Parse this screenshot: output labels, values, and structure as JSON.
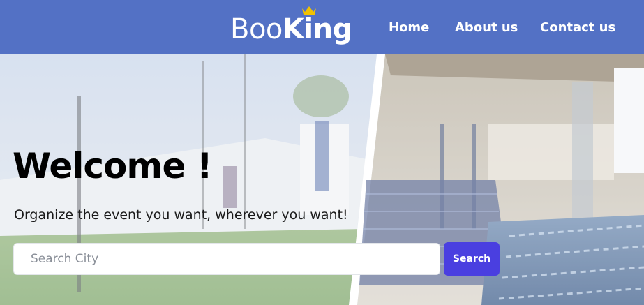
{
  "header": {
    "logo": {
      "part1": "Boo",
      "part2": "King",
      "crown_icon": "crown-icon"
    },
    "nav": [
      {
        "label": "Home"
      },
      {
        "label": "About us"
      },
      {
        "label": "Contact us"
      }
    ]
  },
  "hero": {
    "title": "Welcome !",
    "subtitle": "Organize the event you want, wherever you want!",
    "search": {
      "placeholder": "Search City",
      "value": "",
      "button_label": "Search"
    }
  },
  "colors": {
    "header_bg": "#5371c5",
    "search_button": "#4a3fe0",
    "logo_crown": "#f2c200"
  }
}
